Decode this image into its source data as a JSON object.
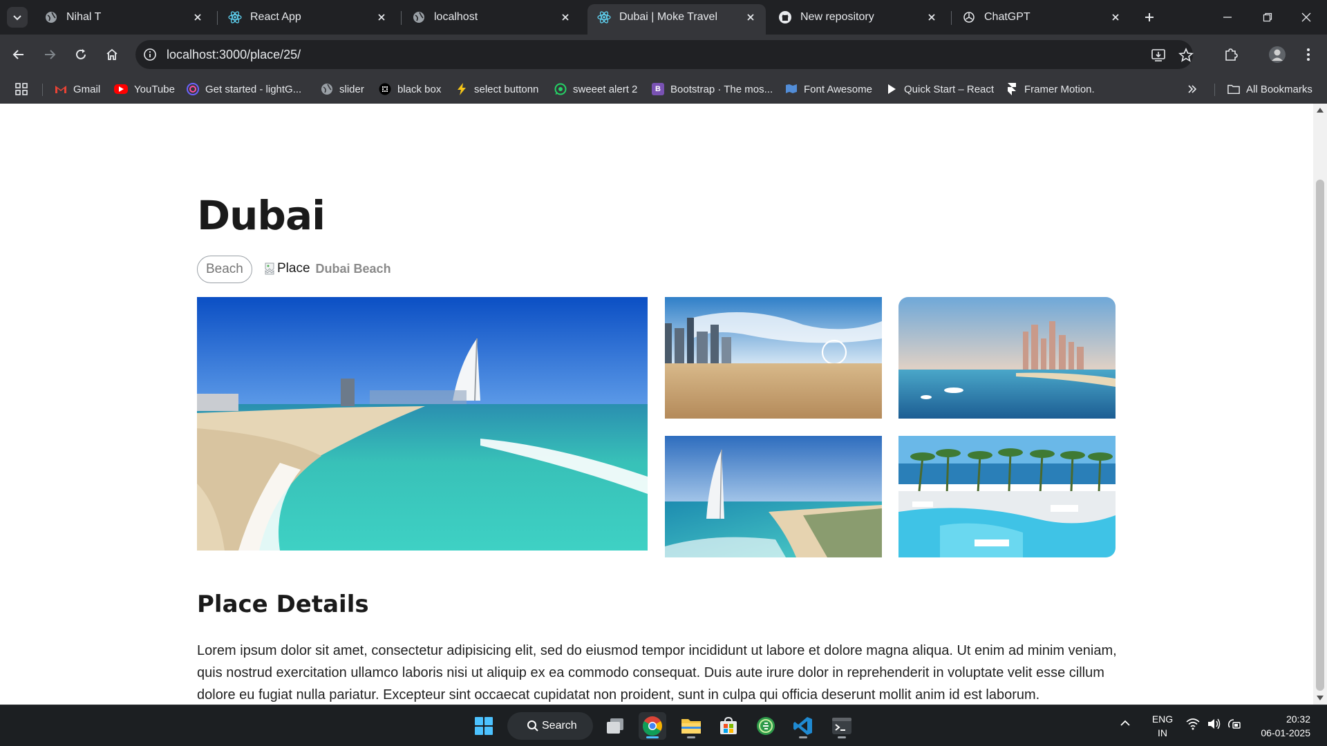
{
  "browser": {
    "tabs": [
      {
        "title": "Nihal T",
        "icon": "globe-icon",
        "active": false
      },
      {
        "title": "React App",
        "icon": "react-icon",
        "active": false
      },
      {
        "title": "localhost",
        "icon": "globe-icon",
        "active": false
      },
      {
        "title": "Dubai | Moke Travel",
        "icon": "react-icon",
        "active": true
      },
      {
        "title": "New repository",
        "icon": "github-icon",
        "active": false
      },
      {
        "title": "ChatGPT",
        "icon": "chatgpt-icon",
        "active": false
      }
    ],
    "url": "localhost:3000/place/25/",
    "bookmarks": [
      {
        "label": "Gmail",
        "icon": "gmail-icon",
        "color": "#ea4335"
      },
      {
        "label": "YouTube",
        "icon": "youtube-icon",
        "color": "#ff0000"
      },
      {
        "label": "Get started - lightG...",
        "icon": "lightgallery-icon",
        "color": "#6c63ff"
      },
      {
        "label": "slider",
        "icon": "globe-icon",
        "color": "#9aa0a6"
      },
      {
        "label": "black box",
        "icon": "blackbox-icon",
        "color": "#000000"
      },
      {
        "label": "select buttonn",
        "icon": "bolt-icon",
        "color": "#f5c518"
      },
      {
        "label": "sweeet alert 2",
        "icon": "whatsapp-icon",
        "color": "#25d366"
      },
      {
        "label": "Bootstrap · The mos...",
        "icon": "bootstrap-icon",
        "color": "#7952b3"
      },
      {
        "label": "Font Awesome",
        "icon": "fontawesome-icon",
        "color": "#528dd7"
      },
      {
        "label": "Quick Start – React",
        "icon": "play-icon",
        "color": "#ffffff"
      },
      {
        "label": "Framer Motion.",
        "icon": "framer-icon",
        "color": "#ffffff"
      }
    ],
    "all_bookmarks_label": "All Bookmarks"
  },
  "page": {
    "title": "Dubai",
    "category_chip": "Beach",
    "broken_image_alt": "Place",
    "place_name": "Dubai Beach",
    "gallery": [
      {
        "name": "main-beach-burj-al-arab-photo"
      },
      {
        "name": "sandy-beach-skyline-photo"
      },
      {
        "name": "marina-skyline-water-photo"
      },
      {
        "name": "burj-al-arab-aerial-photo"
      },
      {
        "name": "beach-club-pool-photo"
      }
    ],
    "section_title": "Place Details",
    "description": "Lorem ipsum dolor sit amet, consectetur adipisicing elit, sed do eiusmod tempor incididunt ut labore et dolore magna aliqua. Ut enim ad minim veniam, quis nostrud exercitation ullamco laboris nisi ut aliquip ex ea commodo consequat. Duis aute irure dolor in reprehenderit in voluptate velit esse cillum dolore eu fugiat nulla pariatur. Excepteur sint occaecat cupidatat non proident, sunt in culpa qui officia deserunt mollit anim id est laborum."
  },
  "taskbar": {
    "search_label": "Search",
    "language_line1": "ENG",
    "language_line2": "IN",
    "time": "20:32",
    "date": "06-01-2025"
  },
  "colors": {
    "tabstrip_bg": "#202124",
    "toolbar_bg": "#35363a",
    "taskbar_bg": "#1c1f22",
    "chip_border": "#9aa0a6",
    "title_text": "#1a1a1a"
  }
}
